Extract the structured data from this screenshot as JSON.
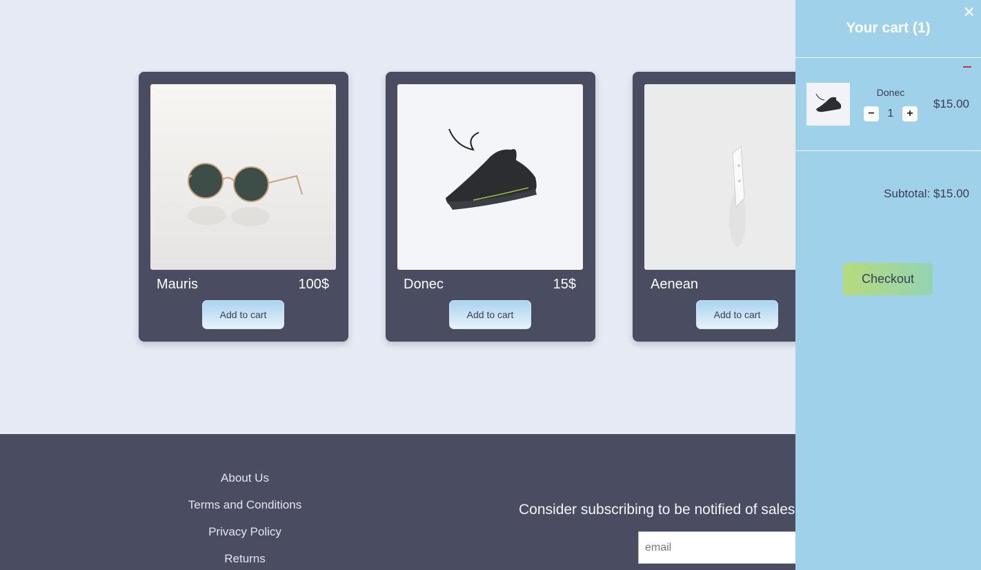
{
  "products": [
    {
      "name": "Mauris",
      "price": "100$",
      "button": "Add to cart",
      "image": "sunglasses"
    },
    {
      "name": "Donec",
      "price": "15$",
      "button": "Add to cart",
      "image": "sneaker"
    },
    {
      "name": "Aenean",
      "price": "",
      "button": "Add to cart",
      "image": "cassette"
    }
  ],
  "footer": {
    "links": [
      "About Us",
      "Terms and Conditions",
      "Privacy Policy",
      "Returns"
    ],
    "subscribe_text": "Consider subscribing to be notified of sales",
    "email_placeholder": "email"
  },
  "cart": {
    "title": "Your cart (1)",
    "close_icon": "close-icon",
    "items": [
      {
        "name": "Donec",
        "quantity": "1",
        "price": "$15.00",
        "decrement": "−",
        "increment": "+"
      }
    ],
    "subtotal": "Subtotal: $15.00",
    "checkout_label": "Checkout"
  },
  "colors": {
    "page_bg": "#e6eaf4",
    "card_bg": "#4a4d62",
    "cart_bg": "#9fd1ea",
    "remove_red": "#c0392b",
    "checkout_gradient_start": "#b5db7c",
    "checkout_gradient_end": "#93d4b3"
  }
}
